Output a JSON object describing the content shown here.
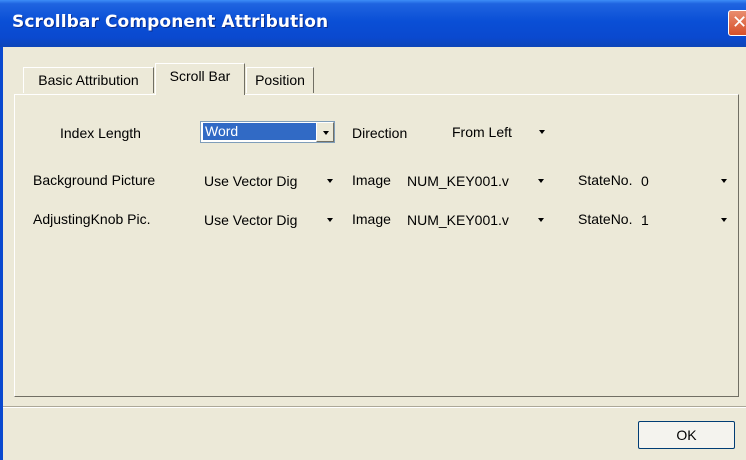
{
  "window": {
    "title": "Scrollbar Component Attribution",
    "close_glyph": "✕"
  },
  "tabs": [
    {
      "label": "Basic Attribution",
      "active": false
    },
    {
      "label": "Scroll Bar",
      "active": true
    },
    {
      "label": "Position",
      "active": false
    }
  ],
  "form": {
    "index_length": {
      "label": "Index Length",
      "value": "Word"
    },
    "direction": {
      "label": "Direction",
      "value": "From Left"
    },
    "background_picture": {
      "label": "Background Picture",
      "source": "Use Vector Dig",
      "image_label": "Image",
      "image_value": "NUM_KEY001.v",
      "state_label": "StateNo.",
      "state_value": "0"
    },
    "adjusting_knob": {
      "label": "AdjustingKnob Pic.",
      "source": "Use Vector Dig",
      "image_label": "Image",
      "image_value": "NUM_KEY001.v",
      "state_label": "StateNo.",
      "state_value": "1"
    }
  },
  "footer": {
    "ok_label": "OK"
  },
  "colors": {
    "titlebar": "#0a49cf",
    "dialog_bg": "#ece9d8",
    "selection": "#316ac5"
  }
}
